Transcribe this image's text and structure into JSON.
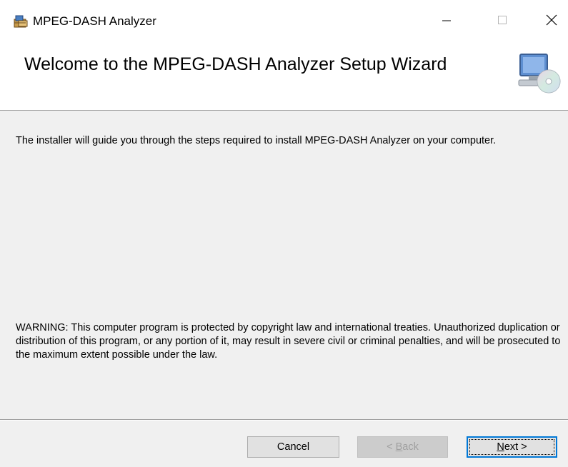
{
  "window": {
    "title": "MPEG-DASH Analyzer",
    "app_icon": "installer-package-icon",
    "controls": {
      "minimize": "minimize-icon",
      "maximize": "maximize-icon",
      "close": "close-icon"
    }
  },
  "header": {
    "heading": "Welcome to the MPEG-DASH Analyzer Setup Wizard",
    "icon": "computer-cd-setup-icon"
  },
  "body": {
    "intro": "The installer will guide you through the steps required to install MPEG-DASH Analyzer on your computer.",
    "warning": "WARNING: This computer program is protected by copyright law and international treaties. Unauthorized duplication or distribution of this program, or any portion of it, may result in severe civil or criminal penalties, and will be prosecuted to the maximum extent possible under the law."
  },
  "buttons": {
    "cancel": "Cancel",
    "back_prefix": "< ",
    "back_mnemonic": "B",
    "back_rest": "ack",
    "next_mnemonic": "N",
    "next_rest": "ext >"
  },
  "colors": {
    "window_bg": "#f0f0f0",
    "header_bg": "#ffffff",
    "focus_accent": "#0078d7",
    "disabled_text": "#a0a0a0"
  }
}
